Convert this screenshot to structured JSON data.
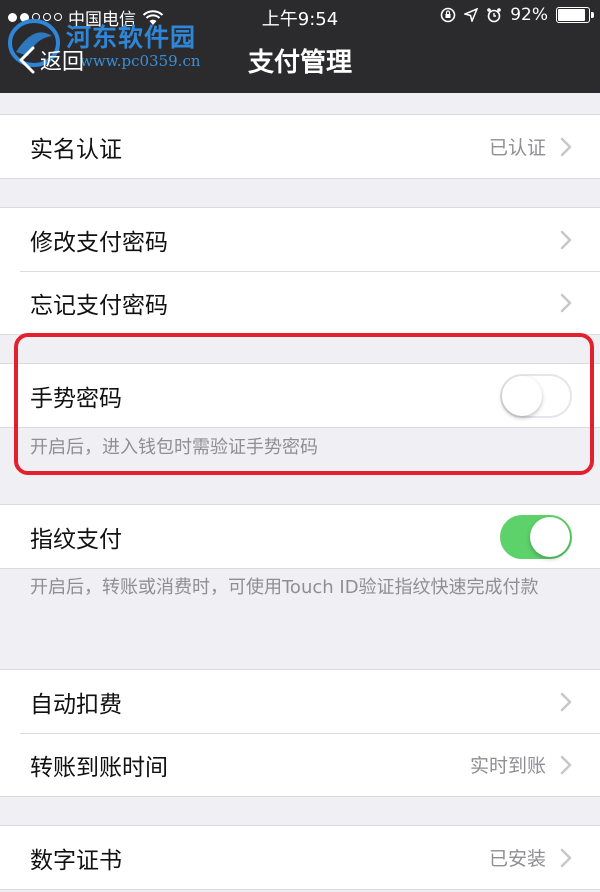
{
  "status_bar": {
    "carrier": "中国电信",
    "time": "上午9:54",
    "battery": "92%",
    "battery_level_percent": 92
  },
  "nav": {
    "back_label": "返回",
    "title": "支付管理"
  },
  "watermark": {
    "name": "河东软件园",
    "url": "www.pc0359.cn"
  },
  "sections": {
    "real_name": {
      "label": "实名认证",
      "value": "已认证"
    },
    "change_password": {
      "label": "修改支付密码"
    },
    "forgot_password": {
      "label": "忘记支付密码"
    },
    "gesture": {
      "label": "手势密码",
      "enabled": false,
      "note": "开启后，进入钱包时需验证手势密码"
    },
    "fingerprint": {
      "label": "指纹支付",
      "enabled": true,
      "note": "开启后，转账或消费时，可使用Touch ID验证指纹快速完成付款"
    },
    "auto_debit": {
      "label": "自动扣费"
    },
    "transfer_time": {
      "label": "转账到账时间",
      "value": "实时到账"
    },
    "certificate": {
      "label": "数字证书",
      "value": "已安装"
    }
  },
  "colors": {
    "nav_background": "#2b2b2d",
    "toggle_on": "#5dd16a",
    "highlight_border": "#e5202e",
    "watermark_blue": "#2f86d8"
  }
}
